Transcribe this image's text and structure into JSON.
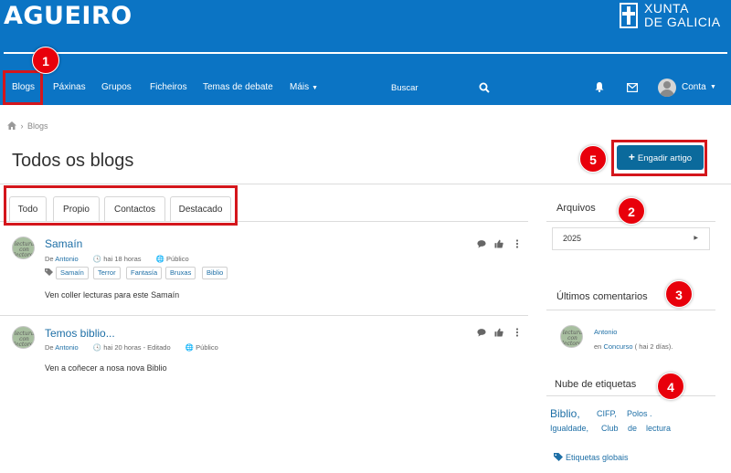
{
  "header": {
    "site_title": "AGUEIRO",
    "logo_line1": "XUNTA",
    "logo_line2": "DE GALICIA"
  },
  "nav": {
    "items": [
      {
        "label": "Blogs"
      },
      {
        "label": "Páxinas"
      },
      {
        "label": "Grupos"
      },
      {
        "label": "Ficheiros"
      },
      {
        "label": "Temas de debate"
      },
      {
        "label": "Máis"
      }
    ],
    "search_placeholder": "Buscar",
    "account_label": "Conta",
    "icons": [
      "search-icon",
      "bell-icon",
      "mail-icon",
      "avatar"
    ]
  },
  "breadcrumb": {
    "label": "Blogs"
  },
  "page": {
    "title": "Todos os blogs",
    "add_button": "Engadir artigo"
  },
  "tabs": [
    {
      "label": "Todo",
      "active": true
    },
    {
      "label": "Propio"
    },
    {
      "label": "Contactos"
    },
    {
      "label": "Destacado"
    }
  ],
  "posts": [
    {
      "title": "Samaín",
      "avatar_text": "lectura con lectores",
      "by": "De",
      "author": "Antonio",
      "time": "hai 18 horas",
      "access": "Público",
      "tags": [
        "Samaín",
        "Terror",
        "Fantasía",
        "Bruxas",
        "Biblio"
      ],
      "excerpt": "Ven coller lecturas para este Samaín"
    },
    {
      "title": "Temos biblio...",
      "avatar_text": "lectura con lectores",
      "by": "De",
      "author": "Antonio",
      "time": "hai 20 horas - Editado",
      "access": "Público",
      "excerpt": "Ven a coñecer a nosa nova Biblio"
    }
  ],
  "sidebar": {
    "archives_title": "Arquivos",
    "archive_year": "2025",
    "comments_title": "Últimos comentarios",
    "comment": {
      "author": "Antonio",
      "prefix": "en",
      "link": "Concurso",
      "time": "( hai 2 días)."
    },
    "tags_title": "Nube de etiquetas",
    "tag_cloud": [
      {
        "label": "Biblio",
        "suffix": ","
      },
      {
        "label": "CIFP",
        "suffix": ","
      },
      {
        "label": "Polos",
        "suffix": "."
      },
      {
        "label": "Igualdade",
        "suffix": ","
      },
      {
        "label": "Club"
      },
      {
        "label": "de"
      },
      {
        "label": "lectura"
      }
    ],
    "global_tags": "Etiquetas globais"
  },
  "annotations": [
    "1",
    "2",
    "3",
    "4",
    "5"
  ],
  "colors": {
    "header_bg": "#0b74c4",
    "button_bg": "#0b6a9c",
    "link": "#1e6fa6",
    "annotation_red": "#e8000b"
  }
}
